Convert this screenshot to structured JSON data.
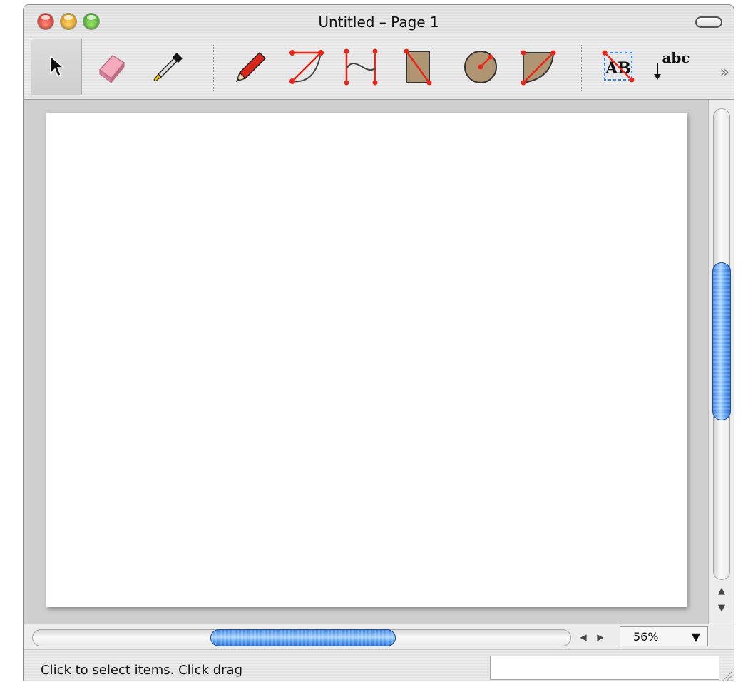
{
  "window": {
    "title": "Untitled – Page 1"
  },
  "toolbar": {
    "tools": [
      {
        "id": "select",
        "icon": "arrow-pointer-icon",
        "selected": true
      },
      {
        "id": "eraser",
        "icon": "eraser-icon"
      },
      {
        "id": "eyedropper",
        "icon": "eyedropper-icon"
      },
      {
        "id": "pencil",
        "icon": "pencil-icon"
      },
      {
        "id": "arc",
        "icon": "arc-tool-icon"
      },
      {
        "id": "bezier",
        "icon": "bezier-curve-icon"
      },
      {
        "id": "rectangle",
        "icon": "rectangle-tool-icon"
      },
      {
        "id": "circle",
        "icon": "circle-tool-icon"
      },
      {
        "id": "wedge",
        "icon": "wedge-tool-icon"
      },
      {
        "id": "text-box",
        "icon": "text-box-icon",
        "label": "AB"
      },
      {
        "id": "text",
        "icon": "text-tool-icon",
        "label": "abc"
      }
    ],
    "overflow_glyph": "»",
    "accent_color": "#e8261a",
    "shape_fill": "#b09573"
  },
  "scrollbars": {
    "vertical_up_glyph": "▲",
    "vertical_down_glyph": "▼",
    "horizontal_left_glyph": "◀",
    "horizontal_right_glyph": "▶",
    "thumb_color": "#3b7fe0"
  },
  "zoom": {
    "value": "56%",
    "arrow": "▼"
  },
  "status": {
    "message": "Click to select items. Click drag"
  }
}
